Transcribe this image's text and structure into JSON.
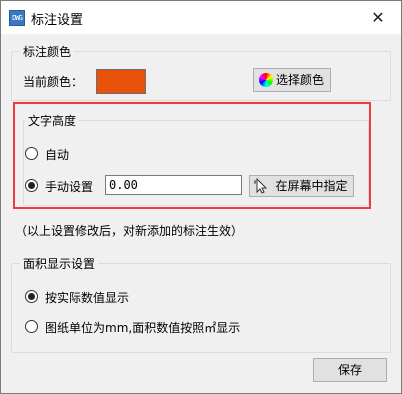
{
  "window": {
    "title": "标注设置",
    "app_icon_text": "DWG",
    "close_glyph": "✕"
  },
  "color_group": {
    "legend": "标注颜色",
    "current_label": "当前颜色：",
    "swatch_color": "#e8520a",
    "pick_button": "选择颜色",
    "pick_icon": "color-wheel-icon"
  },
  "height_group": {
    "legend": "文字高度",
    "auto_label": "自动",
    "manual_label": "手动设置",
    "manual_value": "0.00",
    "selected": "manual",
    "screen_button": "在屏幕中指定",
    "screen_icon": "cursor-icon"
  },
  "note": "（以上设置修改后，对新添加的标注生效）",
  "area_group": {
    "legend": "面积显示设置",
    "option1": "按实际数值显示",
    "option2": "图纸单位为mm,面积数值按照㎡显示",
    "selected": "option1"
  },
  "footer": {
    "save_button": "保存"
  },
  "colors": {
    "highlight": "#ee3b3b",
    "swatch": "#e8520a"
  }
}
